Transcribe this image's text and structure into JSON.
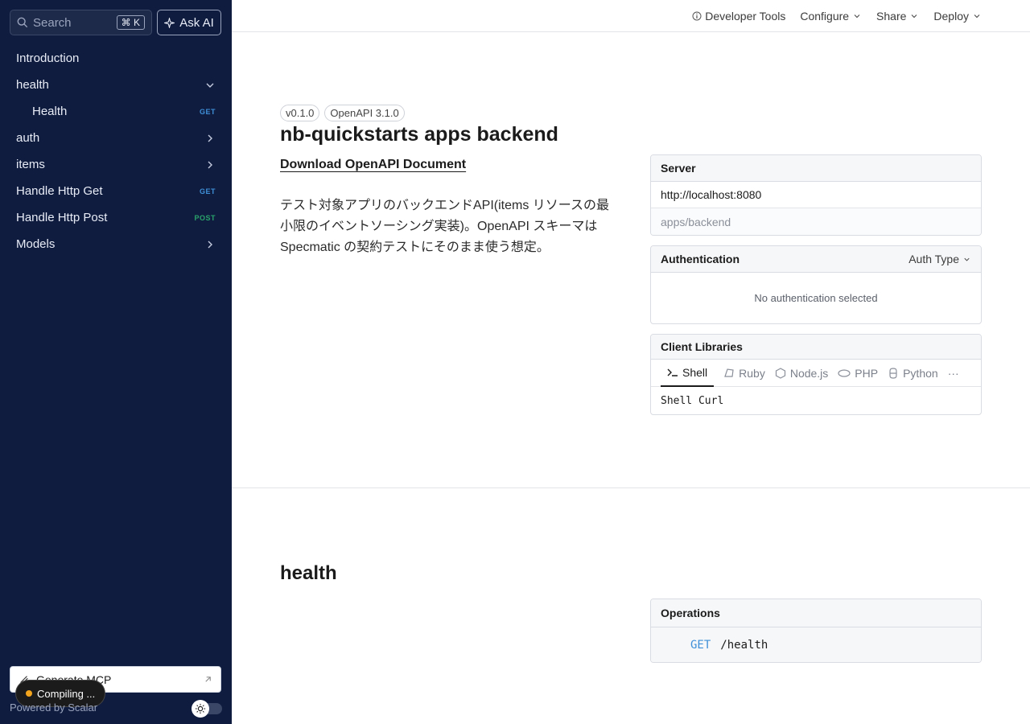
{
  "sidebar": {
    "search_placeholder": "Search",
    "search_shortcut": "⌘ K",
    "ask_ai": "Ask AI",
    "items": [
      {
        "label": "Introduction"
      },
      {
        "label": "health"
      },
      {
        "label": "Health",
        "badge": "GET"
      },
      {
        "label": "auth"
      },
      {
        "label": "items"
      },
      {
        "label": "Handle Http Get",
        "badge": "GET"
      },
      {
        "label": "Handle Http Post",
        "badge": "POST"
      },
      {
        "label": "Models"
      }
    ],
    "mcp_label": "Generate MCP",
    "compiling": "Compiling ...",
    "powered_by": "Powered by Scalar"
  },
  "topbar": {
    "developer_tools": "Developer Tools",
    "configure": "Configure",
    "share": "Share",
    "deploy": "Deploy"
  },
  "intro": {
    "version": "v0.1.0",
    "openapi": "OpenAPI 3.1.0",
    "title": "nb-quickstarts apps backend",
    "download": "Download OpenAPI Document",
    "description": "テスト対象アプリのバックエンドAPI(items リソースの最小限のイベントソーシング実装)。OpenAPI スキーマは Specmatic の契約テストにそのまま使う想定。"
  },
  "server": {
    "heading": "Server",
    "url": "http://localhost:8080",
    "path": "apps/backend"
  },
  "authentication": {
    "heading": "Authentication",
    "auth_type": "Auth Type",
    "empty": "No authentication selected"
  },
  "client_libraries": {
    "heading": "Client Libraries",
    "tabs": [
      "Shell",
      "Ruby",
      "Node.js",
      "PHP",
      "Python"
    ],
    "more": "···",
    "code": "Shell Curl"
  },
  "health_section": {
    "title": "health",
    "ops_heading": "Operations",
    "method": "GET",
    "path": "/health"
  },
  "colors": {
    "sidebar_bg": "#0f1c3f",
    "get": "#3f8fd8",
    "post": "#2aa36b",
    "compiling_dot": "#f3a51d"
  }
}
